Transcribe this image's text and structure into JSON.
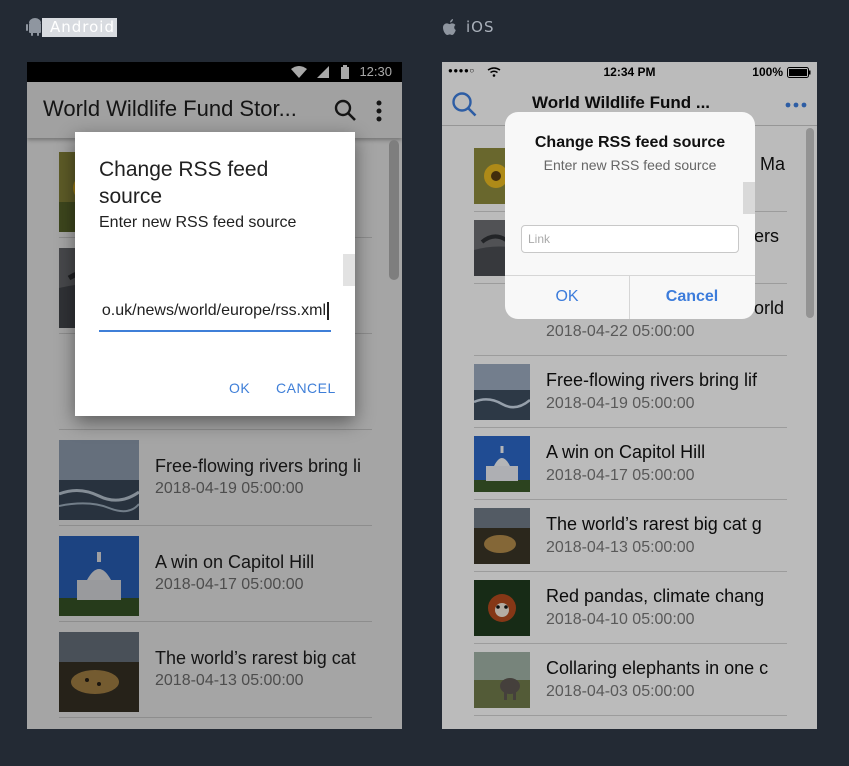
{
  "labels": {
    "android": "Android",
    "ios": "iOS"
  },
  "android": {
    "status_time": "12:30",
    "app_title": "World Wildlife Fund Stor...",
    "dialog": {
      "title": "Change RSS feed source",
      "message": "Enter new RSS feed source",
      "input_value": "o.uk/news/world/europe/rss.xml",
      "ok_label": "OK",
      "cancel_label": "CANCEL"
    },
    "items": [
      {
        "title": "",
        "date": ""
      },
      {
        "title": "",
        "date": ""
      },
      {
        "title": "",
        "date": ""
      },
      {
        "title": "Free-flowing rivers bring li",
        "date": "2018-04-19 05:00:00"
      },
      {
        "title": "A win on Capitol Hill",
        "date": "2018-04-17 05:00:00"
      },
      {
        "title": "The world’s rarest big cat",
        "date": "2018-04-13 05:00:00"
      }
    ]
  },
  "ios": {
    "carrier_dots": "●●●●○",
    "status_time": "12:34 PM",
    "battery": "100%",
    "nav_title": "World Wildlife Fund ...",
    "alert": {
      "title": "Change RSS feed source",
      "message": "Enter new RSS feed source",
      "placeholder": "Link",
      "ok_label": "OK",
      "cancel_label": "Cancel"
    },
    "items": [
      {
        "title": "Ma",
        "date": ""
      },
      {
        "title": "ers",
        "date": ""
      },
      {
        "title": "orld",
        "date": "2018-04-22 05:00:00"
      },
      {
        "title": "Free-flowing rivers bring lif",
        "date": "2018-04-19 05:00:00"
      },
      {
        "title": "A win on Capitol Hill",
        "date": "2018-04-17 05:00:00"
      },
      {
        "title": "The world’s rarest big cat g",
        "date": "2018-04-13 05:00:00"
      },
      {
        "title": "Red pandas, climate chang",
        "date": "2018-04-10 05:00:00"
      },
      {
        "title": "Collaring elephants in one c",
        "date": "2018-04-03 05:00:00"
      }
    ]
  },
  "colors": {
    "accent": "#3f7fd8",
    "ios_tint": "#3c7cdb",
    "page_bg": "#232a34"
  }
}
